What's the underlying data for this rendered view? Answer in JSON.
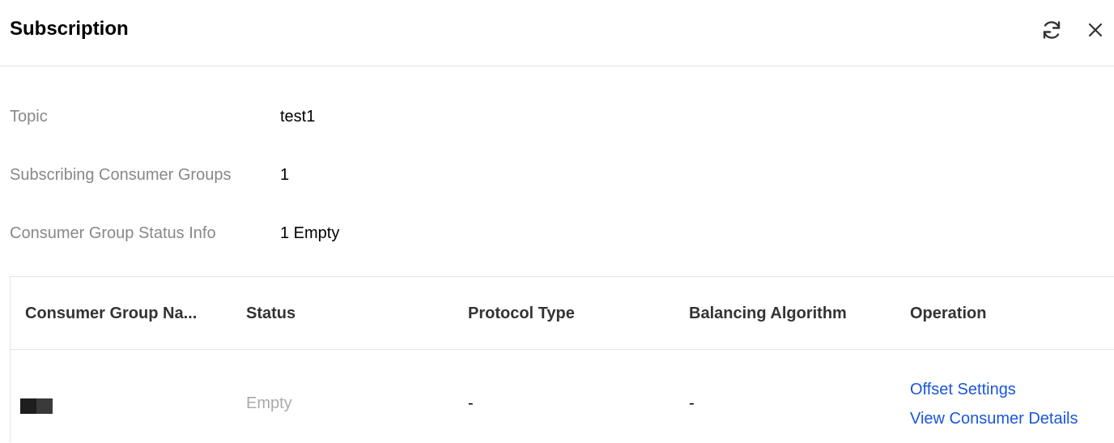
{
  "header": {
    "title": "Subscription",
    "refresh_icon": "refresh-icon",
    "close_icon": "close-icon"
  },
  "info": {
    "topic_label": "Topic",
    "topic_value": "test1",
    "groups_label": "Subscribing Consumer Groups",
    "groups_value": "1",
    "status_label": "Consumer Group Status Info",
    "status_value": "1 Empty"
  },
  "table": {
    "columns": [
      "Consumer Group Na...",
      "Status",
      "Protocol Type",
      "Balancing Algorithm",
      "Operation"
    ],
    "rows": [
      {
        "status": "Empty",
        "protocol": "-",
        "algorithm": "-",
        "ops": [
          "Offset Settings",
          "View Consumer Details"
        ]
      }
    ]
  },
  "colors": {
    "link": "#1a56db",
    "label": "#888888",
    "muted": "#aaaaaa"
  }
}
